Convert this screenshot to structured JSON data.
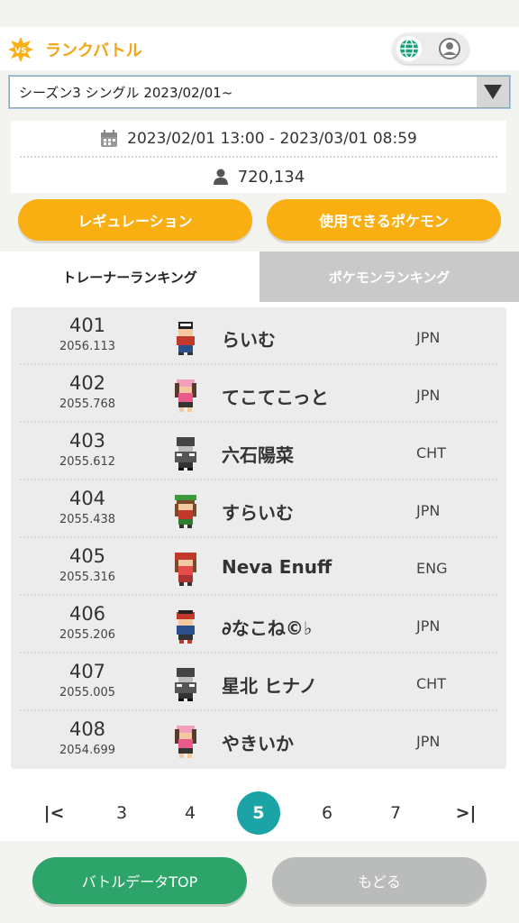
{
  "header": {
    "vs_badge": "VS",
    "title": "ランクバトル",
    "globe_icon": "globe-icon",
    "user_icon": "user-icon"
  },
  "season_select": {
    "selected": "シーズン3 シングル 2023/02/01~"
  },
  "info": {
    "period": "2023/02/01 13:00 - 2023/03/01 08:59",
    "participants": "720,134"
  },
  "buttons": {
    "regulation": "レギュレーション",
    "usable_pokemon": "使用できるポケモン",
    "battle_data_top": "バトルデータTOP",
    "back": "もどる"
  },
  "tabs": {
    "trainer_ranking": "トレーナーランキング",
    "pokemon_ranking": "ポケモンランキング"
  },
  "ranking": [
    {
      "rank": "401",
      "rating": "2056.113",
      "name": "らいむ",
      "country": "JPN"
    },
    {
      "rank": "402",
      "rating": "2055.768",
      "name": "てこてこっと",
      "country": "JPN"
    },
    {
      "rank": "403",
      "rating": "2055.612",
      "name": "六石陽菜",
      "country": "CHT"
    },
    {
      "rank": "404",
      "rating": "2055.438",
      "name": "すらいむ",
      "country": "JPN"
    },
    {
      "rank": "405",
      "rating": "2055.316",
      "name": "Neva Enuff",
      "country": "ENG"
    },
    {
      "rank": "406",
      "rating": "2055.206",
      "name": "∂なこね©♭",
      "country": "JPN"
    },
    {
      "rank": "407",
      "rating": "2055.005",
      "name": "星北 ヒナノ",
      "country": "CHT"
    },
    {
      "rank": "408",
      "rating": "2054.699",
      "name": "やきいか",
      "country": "JPN"
    }
  ],
  "pager": {
    "first": "|<",
    "last": ">|",
    "pages": [
      "3",
      "4",
      "5",
      "6",
      "7"
    ],
    "current": "5"
  },
  "colors": {
    "accent_orange": "#f9ae12",
    "title_orange": "#f2a516",
    "active_page_teal": "#1ba4a6",
    "green_button": "#2ca46a",
    "gray_button": "#b9bcba"
  }
}
